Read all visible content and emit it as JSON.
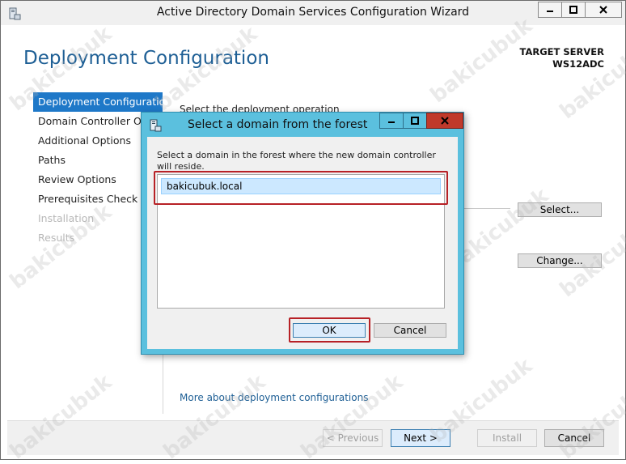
{
  "window": {
    "title": "Active Directory Domain Services Configuration Wizard"
  },
  "page": {
    "title": "Deployment Configuration",
    "target_server_label": "TARGET SERVER",
    "target_server_name": "WS12ADC"
  },
  "nav": {
    "items": [
      {
        "label": "Deployment Configuration",
        "state": "active"
      },
      {
        "label": "Domain Controller Options",
        "state": "normal"
      },
      {
        "label": "Additional Options",
        "state": "normal"
      },
      {
        "label": "Paths",
        "state": "normal"
      },
      {
        "label": "Review Options",
        "state": "normal"
      },
      {
        "label": "Prerequisites Check",
        "state": "normal"
      },
      {
        "label": "Installation",
        "state": "disabled"
      },
      {
        "label": "Results",
        "state": "disabled"
      }
    ]
  },
  "main": {
    "instruction": "Select the deployment operation",
    "select_button": "Select...",
    "change_button": "Change...",
    "more_link": "More about deployment configurations"
  },
  "footer": {
    "previous": "< Previous",
    "next": "Next >",
    "install": "Install",
    "cancel": "Cancel"
  },
  "dialog": {
    "title": "Select a domain from the forest",
    "instruction": "Select a domain in the forest where the new domain controller will reside.",
    "domains": [
      "bakicubuk.local"
    ],
    "ok": "OK",
    "cancel": "Cancel"
  },
  "colors": {
    "accent": "#1e78c8",
    "title_blue": "#1e5f95",
    "dialog_frame": "#5bc0de",
    "highlight_red": "#b72126"
  },
  "watermark": "bakicubuk"
}
